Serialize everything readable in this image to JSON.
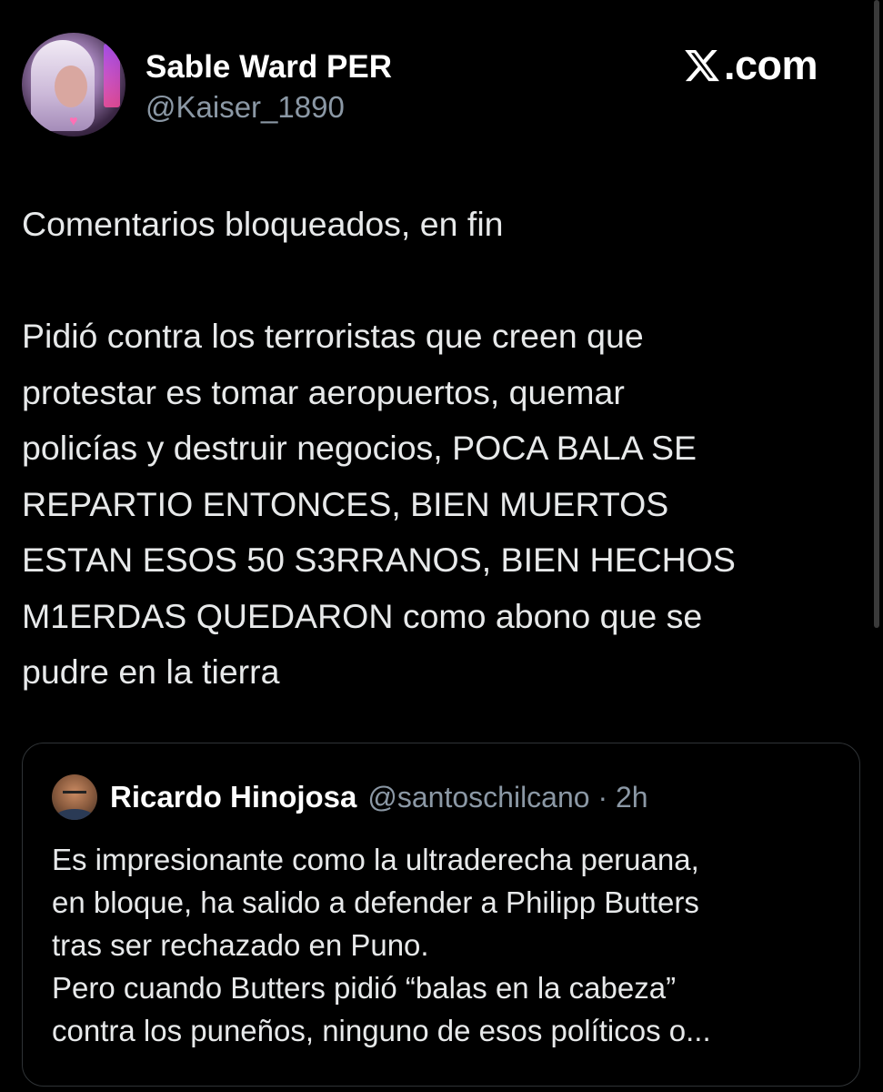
{
  "author": {
    "display_name": "Sable Ward PER",
    "handle": "@Kaiser_1890"
  },
  "brand": {
    "text": ".com"
  },
  "tweet": {
    "paragraphs": [
      "Comentarios bloqueados, en fin",
      "Pidió contra los terroristas que creen que\nprotestar es tomar aeropuertos, quemar\npolicías y destruir negocios, POCA BALA SE\nREPARTIO ENTONCES, BIEN MUERTOS\nESTAN ESOS 50 S3RRANOS, BIEN HECHOS\nM1ERDAS QUEDARON como abono que se\npudre en la tierra"
    ]
  },
  "quoted_tweet": {
    "author_name": "Ricardo Hinojosa",
    "meta": "@santoschilcano · 2h",
    "text": "Es impresionante como la ultraderecha peruana,\nen bloque, ha salido a defender a Philipp Butters\ntras ser rechazado en Puno.\nPero cuando Butters pidió “balas en la cabeza”\ncontra los puneños, ninguno de esos políticos o..."
  },
  "colors": {
    "background": "#000000",
    "primary_text": "#e7e9ea",
    "secondary_text": "#8b98a5",
    "border": "#2f3336"
  },
  "icons": {
    "brand_logo": "x-logo-icon"
  }
}
